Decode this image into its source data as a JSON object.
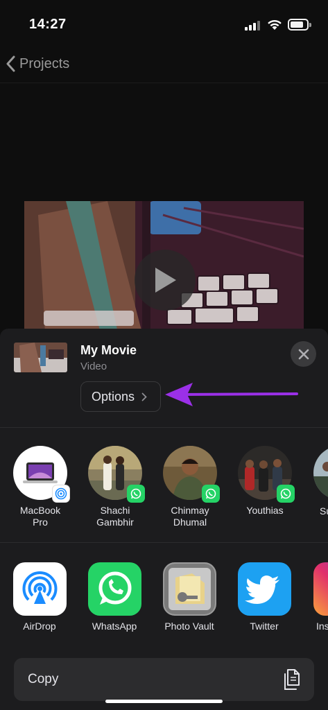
{
  "status": {
    "time": "14:27"
  },
  "nav": {
    "back_label": "Projects"
  },
  "share_header": {
    "title": "My Movie",
    "subtitle": "Video",
    "options_label": "Options"
  },
  "people": [
    {
      "name": "MacBook\nPro",
      "badge": "airdrop"
    },
    {
      "name": "Shachi\nGambhir",
      "badge": "whatsapp"
    },
    {
      "name": "Chinmay\nDhumal",
      "badge": "whatsapp"
    },
    {
      "name": "Youthias",
      "badge": "whatsapp"
    },
    {
      "name": "Su",
      "badge": ""
    }
  ],
  "apps": [
    {
      "label": "AirDrop",
      "icon": "airdrop-icon"
    },
    {
      "label": "WhatsApp",
      "icon": "whatsapp-icon"
    },
    {
      "label": "Photo Vault",
      "icon": "photo-vault-icon"
    },
    {
      "label": "Twitter",
      "icon": "twitter-icon"
    },
    {
      "label": "Ins",
      "icon": "instagram-icon"
    }
  ],
  "actions": {
    "copy_label": "Copy"
  },
  "colors": {
    "accent_arrow": "#9b30e8",
    "whatsapp": "#25d366",
    "twitter": "#1da1f2",
    "airdrop": "#1a8cff"
  }
}
